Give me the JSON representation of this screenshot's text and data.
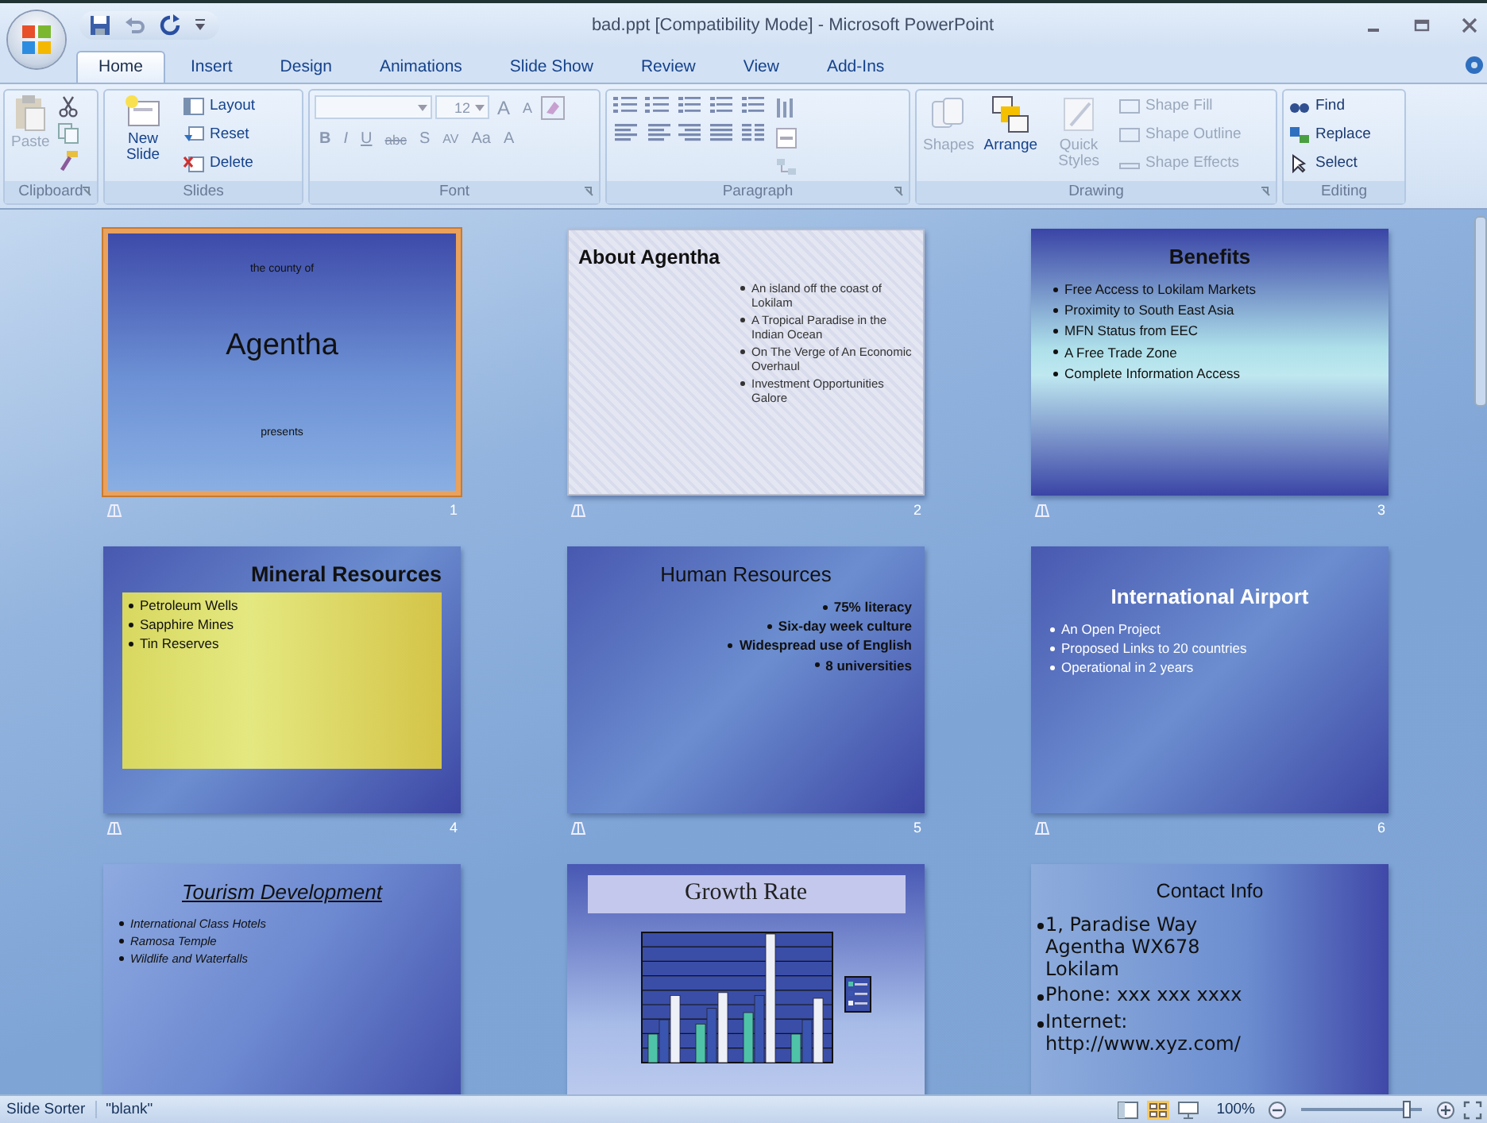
{
  "window": {
    "title": "bad.ppt [Compatibility Mode] - Microsoft PowerPoint"
  },
  "tabs": [
    {
      "label": "Home",
      "selected": true
    },
    {
      "label": "Insert",
      "selected": false
    },
    {
      "label": "Design",
      "selected": false
    },
    {
      "label": "Animations",
      "selected": false
    },
    {
      "label": "Slide Show",
      "selected": false
    },
    {
      "label": "Review",
      "selected": false
    },
    {
      "label": "View",
      "selected": false
    },
    {
      "label": "Add-Ins",
      "selected": false
    }
  ],
  "ribbon": {
    "clipboard": {
      "label": "Clipboard",
      "paste": {
        "label": "Paste",
        "disabled": true
      }
    },
    "slides": {
      "label": "Slides",
      "new_slide": "New Slide",
      "items": [
        "Layout",
        "Reset",
        "Delete"
      ]
    },
    "font": {
      "label": "Font",
      "size": "12",
      "size_buttons": [
        "A",
        "A"
      ],
      "format_buttons": [
        "B",
        "I",
        "U",
        "abc",
        "S",
        "AV",
        "Aa",
        "A"
      ],
      "disabled": true
    },
    "paragraph": {
      "label": "Paragraph"
    },
    "drawing": {
      "label": "Drawing",
      "buttons": [
        {
          "label": "Shapes",
          "disabled": true
        },
        {
          "label": "Arrange",
          "disabled": false
        },
        {
          "label": "Quick Styles",
          "disabled": true
        }
      ],
      "items": [
        {
          "label": "Shape Fill",
          "disabled": true
        },
        {
          "label": "Shape Outline",
          "disabled": true
        },
        {
          "label": "Shape Effects",
          "disabled": true
        }
      ]
    },
    "editing": {
      "label": "Editing",
      "items": [
        "Find",
        "Replace",
        "Select"
      ]
    }
  },
  "slides": [
    {
      "number": "1",
      "selected": true,
      "kind": "title",
      "pretitle": "the county of",
      "title": "Agentha",
      "subtitle": "presents"
    },
    {
      "number": "2",
      "selected": false,
      "kind": "bullets",
      "title": "About Agentha",
      "bullets": [
        "An island off the coast of Lokilam",
        "A Tropical Paradise in the Indian Ocean",
        "On The Verge of An Economic Overhaul",
        "Investment Opportunities Galore"
      ]
    },
    {
      "number": "3",
      "selected": false,
      "kind": "bullets",
      "title": "Benefits",
      "bullets": [
        "Free Access to Lokilam Markets",
        "Proximity to South East Asia",
        "MFN Status from EEC",
        "A Free Trade Zone",
        "Complete Information Access"
      ]
    },
    {
      "number": "4",
      "selected": false,
      "kind": "bullets",
      "title": "Mineral Resources",
      "bullets": [
        "Petroleum Wells",
        "Sapphire Mines",
        "Tin Reserves"
      ]
    },
    {
      "number": "5",
      "selected": false,
      "kind": "bullets",
      "title": "Human Resources",
      "bullets": [
        "75% literacy",
        "Six-day week culture",
        "Widespread use of English",
        "8 universities"
      ]
    },
    {
      "number": "6",
      "selected": false,
      "kind": "bullets",
      "title": "International Airport",
      "bullets": [
        "An Open Project",
        "Proposed Links to 20 countries",
        "Operational in 2 years"
      ]
    },
    {
      "selected": false,
      "kind": "bullets",
      "title": "Tourism Development",
      "bullets": [
        "International Class Hotels",
        "Ramosa Temple",
        "Wildlife and Waterfalls"
      ]
    },
    {
      "selected": false,
      "kind": "chart",
      "title": "Growth Rate"
    },
    {
      "selected": false,
      "kind": "bullets",
      "title": "Contact Info",
      "bullets": [
        "1, Paradise Way\nAgentha WX678\nLokilam",
        "Phone: xxx xxx xxxx",
        "Internet:\nhttp://www.xyz.com/"
      ]
    }
  ],
  "status_bar": {
    "view": "Slide Sorter",
    "theme": "\"blank\"",
    "zoom": "100%",
    "zoom_slider": {
      "level": 0.88
    }
  }
}
